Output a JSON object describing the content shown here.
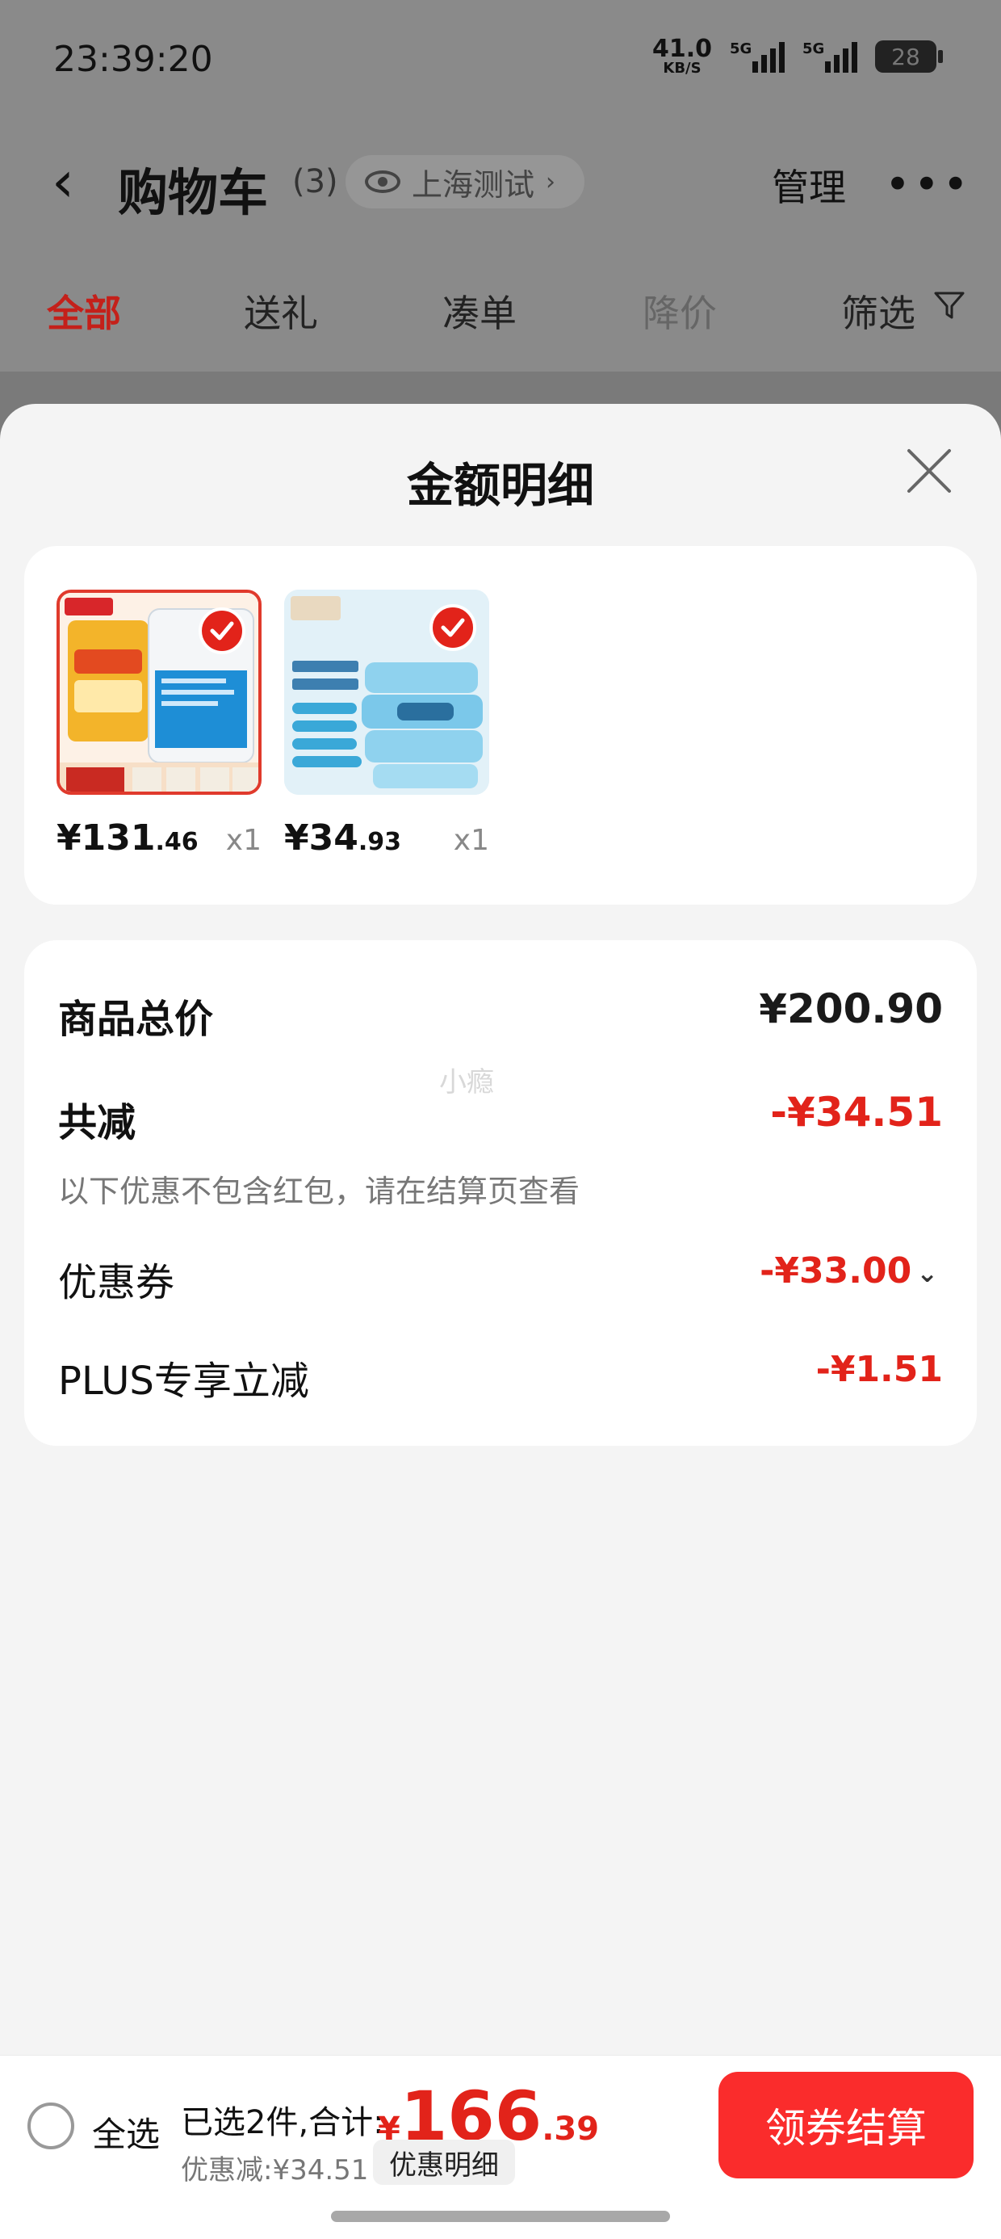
{
  "status_bar": {
    "time": "23:39:20",
    "net_speed": "41.0",
    "net_unit": "KB/S",
    "sig1_tag": "5G",
    "sig2_tag": "5G",
    "battery": "28"
  },
  "header": {
    "title": "购物车",
    "count": "(3)",
    "location": "上海测试",
    "manage": "管理",
    "more": "•••"
  },
  "filters": {
    "tabs": [
      "全部",
      "送礼",
      "凑单",
      "降价"
    ],
    "filter_label": "筛选"
  },
  "sheet": {
    "title": "金额明细",
    "products": [
      {
        "price_int": "¥131",
        "price_dec": ".46",
        "qty": "x1"
      },
      {
        "price_int": "¥34",
        "price_dec": ".93",
        "qty": "x1"
      }
    ],
    "summary": {
      "total_label": "商品总价",
      "total_value": "¥200.90",
      "watermark": "小瘾",
      "reduce_label": "共减",
      "reduce_value": "-¥34.51",
      "note": "以下优惠不包含红包，请在结算页查看",
      "coupon_label": "优惠券",
      "coupon_value": "-¥33.00",
      "plus_label": "PLUS专享立减",
      "plus_value": "-¥1.51"
    }
  },
  "bottom_bar": {
    "select_all": "全选",
    "selected": "已选2件,合计:",
    "currency": "¥",
    "total_int": "166",
    "total_dec": ".39",
    "discount": "优惠减:¥34.51",
    "detail": "优惠明细",
    "checkout": "领券结算"
  },
  "colors": {
    "accent": "#e2231a",
    "checkout": "#fa2c2c"
  }
}
